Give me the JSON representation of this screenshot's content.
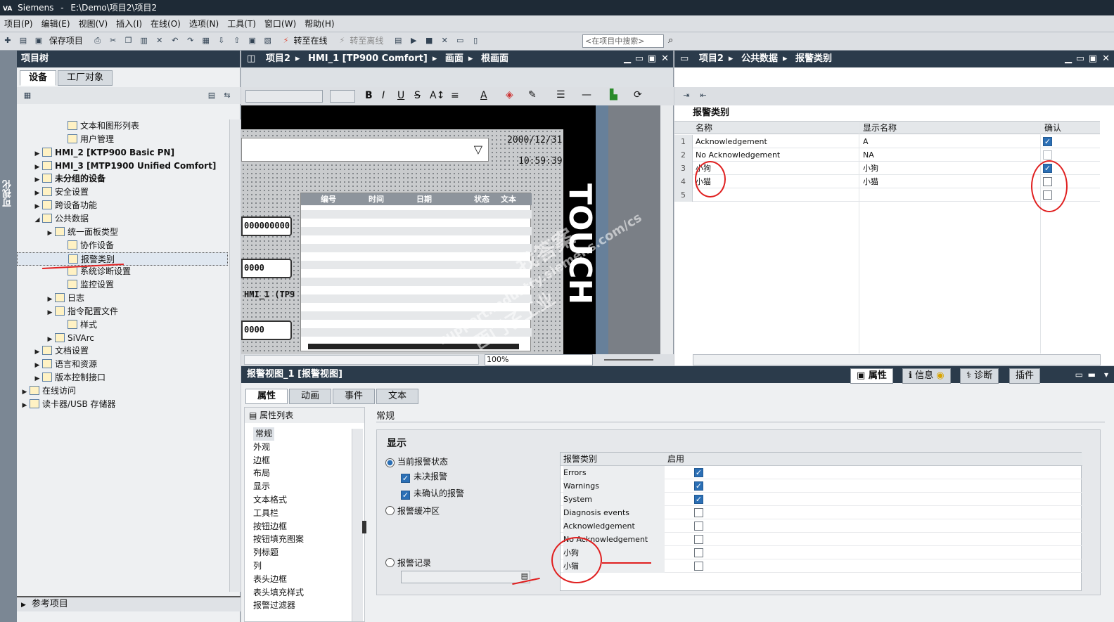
{
  "titlebar": {
    "logo": "VA",
    "app": "Siemens",
    "sep": "-",
    "path": "E:\\Demo\\项目2\\项目2"
  },
  "menu": [
    "项目(P)",
    "编辑(E)",
    "视图(V)",
    "插入(I)",
    "在线(O)",
    "选项(N)",
    "工具(T)",
    "窗口(W)",
    "帮助(H)"
  ],
  "toolbar": {
    "save_label": "保存项目",
    "online_label": "转至在线",
    "offline_label": "转至离线",
    "search_placeholder": "<在项目中搜索>"
  },
  "sidestrip": {
    "label": "可视化"
  },
  "project_tree": {
    "title": "项目树",
    "tabs": [
      "设备",
      "工厂对象"
    ],
    "items": [
      {
        "label": "文本和图形列表",
        "level": 3,
        "arrow": ""
      },
      {
        "label": "用户管理",
        "level": 3,
        "arrow": ""
      },
      {
        "label": "HMI_2 [KTP900 Basic PN]",
        "level": 1,
        "arrow": "▶",
        "bold": true
      },
      {
        "label": "HMI_3 [MTP1900 Unified Comfort]",
        "level": 1,
        "arrow": "▶",
        "bold": true
      },
      {
        "label": "未分组的设备",
        "level": 1,
        "arrow": "▶",
        "bold": true
      },
      {
        "label": "安全设置",
        "level": 1,
        "arrow": "▶"
      },
      {
        "label": "跨设备功能",
        "level": 1,
        "arrow": "▶"
      },
      {
        "label": "公共数据",
        "level": 1,
        "arrow": "◢"
      },
      {
        "label": "统一面板类型",
        "level": 2,
        "arrow": "▶"
      },
      {
        "label": "协作设备",
        "level": 3,
        "arrow": ""
      },
      {
        "label": "报警类别",
        "level": 3,
        "arrow": "",
        "selected": true
      },
      {
        "label": "系统诊断设置",
        "level": 3,
        "arrow": ""
      },
      {
        "label": "监控设置",
        "level": 3,
        "arrow": ""
      },
      {
        "label": "日志",
        "level": 2,
        "arrow": "▶"
      },
      {
        "label": "指令配置文件",
        "level": 2,
        "arrow": "▶"
      },
      {
        "label": "样式",
        "level": 3,
        "arrow": ""
      },
      {
        "label": "SiVArc",
        "level": 2,
        "arrow": "▶"
      },
      {
        "label": "文档设置",
        "level": 1,
        "arrow": "▶"
      },
      {
        "label": "语言和资源",
        "level": 1,
        "arrow": "▶"
      },
      {
        "label": "版本控制接口",
        "level": 1,
        "arrow": "▶"
      },
      {
        "label": "在线访问",
        "level": 0,
        "arrow": "▶"
      },
      {
        "label": "读卡器/USB 存储器",
        "level": 0,
        "arrow": "▶"
      }
    ],
    "bottom": "参考项目"
  },
  "editor": {
    "breadcrumb": [
      "项目2",
      "HMI_1 [TP900 Comfort]",
      "画面",
      "根画面"
    ],
    "date": "2000/12/31",
    "time": "10:59:39",
    "touch": "TOUCH",
    "pills": [
      "000000000",
      "0000",
      "0000"
    ],
    "hmi_label": "HMI_1 (TP9",
    "alarm_columns": [
      "编号",
      "时间",
      "日期",
      "状态",
      "文本"
    ],
    "zoom": "100%"
  },
  "alarm_classes": {
    "breadcrumb": [
      "项目2",
      "公共数据",
      "报警类别"
    ],
    "title": "报警类别",
    "columns": [
      "名称",
      "显示名称",
      "确认"
    ],
    "rows": [
      {
        "num": "1",
        "name": "Acknowledgement",
        "display": "A",
        "ack": "checked"
      },
      {
        "num": "2",
        "name": "No Acknowledgement",
        "display": "NA",
        "ack": "disabled"
      },
      {
        "num": "3",
        "name": "小狗",
        "display": "小狗",
        "ack": "checked"
      },
      {
        "num": "4",
        "name": "小猫",
        "display": "小猫",
        "ack": "empty"
      },
      {
        "num": "5",
        "name": "",
        "display": "",
        "ack": "empty"
      }
    ]
  },
  "properties": {
    "object_title": "报警视图_1 [报警视图]",
    "right_tabs": [
      "属性",
      "信息",
      "诊断",
      "插件"
    ],
    "tabs": [
      "属性",
      "动画",
      "事件",
      "文本"
    ],
    "list_title": "属性列表",
    "list": [
      "常规",
      "外观",
      "边框",
      "布局",
      "显示",
      "文本格式",
      "工具栏",
      "按钮边框",
      "按钮填充图案",
      "列标题",
      "列",
      "表头边框",
      "表头填充样式",
      "报警过滤器"
    ],
    "section": "常规",
    "group": "显示",
    "radio_current": "当前报警状态",
    "chk_pending": "未决报警",
    "chk_unack": "未确认的报警",
    "radio_buffer": "报警缓冲区",
    "radio_log": "报警记录",
    "cat_columns": [
      "报警类别",
      "启用"
    ],
    "categories": [
      {
        "name": "Errors",
        "enabled": true
      },
      {
        "name": "Warnings",
        "enabled": true
      },
      {
        "name": "System",
        "enabled": true
      },
      {
        "name": "Diagnosis events",
        "enabled": false
      },
      {
        "name": "Acknowledgement",
        "enabled": false
      },
      {
        "name": "No Acknowledgement",
        "enabled": false
      },
      {
        "name": "小狗",
        "enabled": false
      },
      {
        "name": "小猫",
        "enabled": false
      }
    ]
  },
  "watermark": {
    "line1": "找答案",
    "line2": "support.industry.siemens.com/cs",
    "line3": "西门子工业"
  },
  "colors": {
    "header": "#2b3b4b",
    "accent": "#2b6fb5",
    "annotation": "#e02020"
  }
}
